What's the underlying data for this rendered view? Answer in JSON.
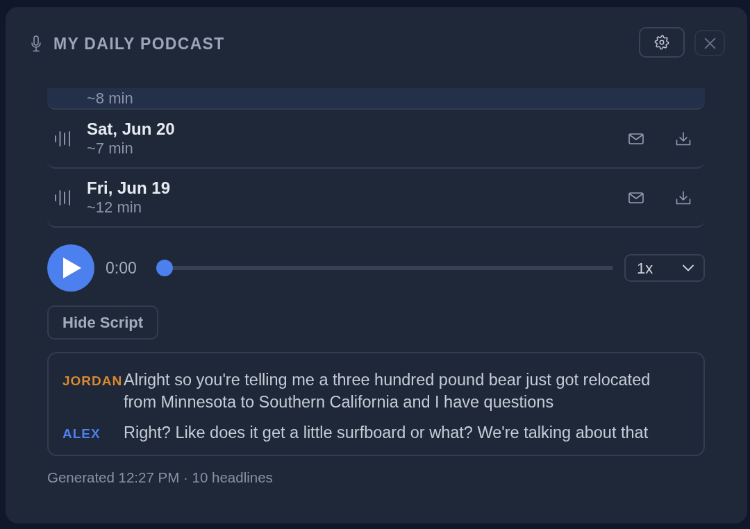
{
  "header": {
    "title": "MY DAILY PODCAST"
  },
  "episodes": [
    {
      "duration": "~8 min",
      "selected": true
    },
    {
      "title": "Sat, Jun 20",
      "duration": "~7 min",
      "selected": false
    },
    {
      "title": "Fri, Jun 19",
      "duration": "~12 min",
      "selected": false
    }
  ],
  "player": {
    "time": "0:00",
    "level": 0,
    "speed": "1x"
  },
  "script_toggle": {
    "label": "Hide Script"
  },
  "script": [
    {
      "speaker": "JORDAN",
      "color": "#d98a30",
      "text": "Alright so you're telling me a three hundred pound bear just got relocated from Minnesota to Southern California and I have questions"
    },
    {
      "speaker": "ALEX",
      "color": "#4c80ee",
      "text": "Right? Like does it get a little surfboard or what? We're talking about that"
    }
  ],
  "footer": "Generated 12:27 PM · 10 headlines"
}
